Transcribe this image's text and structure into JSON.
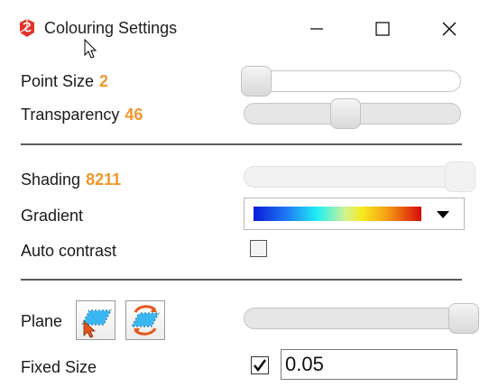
{
  "window": {
    "title": "Colouring Settings",
    "icon": "sketchup-logo-icon",
    "controls": {
      "minimize": "minimize-icon",
      "maximize": "maximize-icon",
      "close": "close-icon"
    }
  },
  "point_size": {
    "label": "Point Size",
    "value": "2",
    "slider_level": 0.0
  },
  "transparency": {
    "label": "Transparency",
    "value": "46",
    "slider_level": 0.46
  },
  "shading": {
    "label": "Shading",
    "value": "8211",
    "slider_level": 1.0
  },
  "gradient": {
    "label": "Gradient",
    "selected": "blue-cyan-yellow-red",
    "colors": [
      "#0a1bd8",
      "#1f7cf4",
      "#1ff0f5",
      "#d5f28f",
      "#f6e91b",
      "#f59b14",
      "#d80a0a"
    ]
  },
  "auto_contrast": {
    "label": "Auto contrast",
    "checked": false
  },
  "plane": {
    "label": "Plane",
    "buttons": [
      "plane-pick-icon",
      "plane-rotate-icon"
    ],
    "slider_level": 1.0
  },
  "fixed_size": {
    "label": "Fixed Size",
    "checked": true,
    "value": "0.05"
  },
  "accent_color": "#f0962a"
}
